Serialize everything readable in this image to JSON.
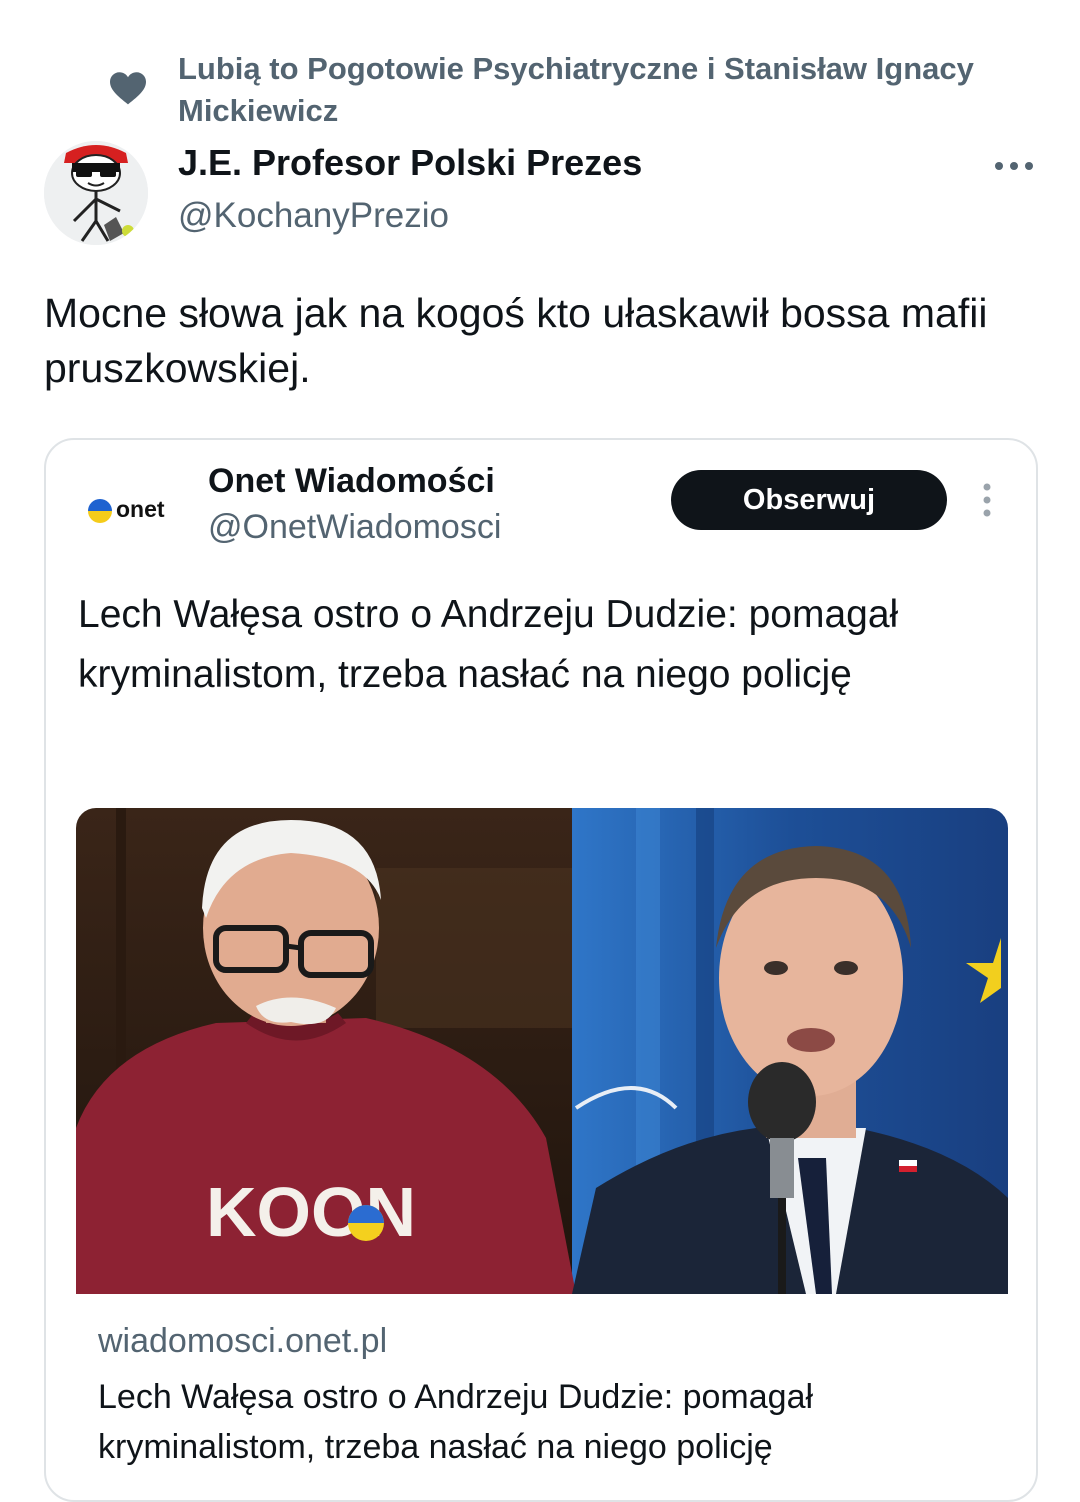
{
  "social_context": {
    "liked_by_text": "Lubią to Pogotowie Psychiatryczne i Stanisław Ignacy Mickiewicz"
  },
  "author": {
    "display_name": "J.E. Profesor Polski Prezes",
    "handle": "@KochanyPrezio"
  },
  "tweet": {
    "text": "Mocne słowa jak na kogoś kto ułaskawił bossa mafii pruszkowskiej."
  },
  "quoted": {
    "logo_text": "onet",
    "display_name": "Onet Wiadomości",
    "handle": "@OnetWiadomosci",
    "follow_label": "Obserwuj",
    "text": "Lech Wałęsa ostro o Andrzeju Dudzie: pomagał kryminalistom, trzeba nasłać na niego policję",
    "image": {
      "sweater_text": "KOON"
    },
    "link": {
      "domain": "wiadomosci.onet.pl",
      "title": "Lech Wałęsa ostro o Andrzeju Dudzie: pomagał kryminalistom, trzeba nasłać na niego policję"
    }
  },
  "icons": {
    "heart": "heart-icon",
    "more": "more-horizontal-icon",
    "quoted_more": "more-vertical-icon"
  },
  "colors": {
    "text_primary": "#0f1419",
    "text_secondary": "#536471",
    "follow_button_bg": "#0f1419",
    "border": "#dfe3e6"
  }
}
